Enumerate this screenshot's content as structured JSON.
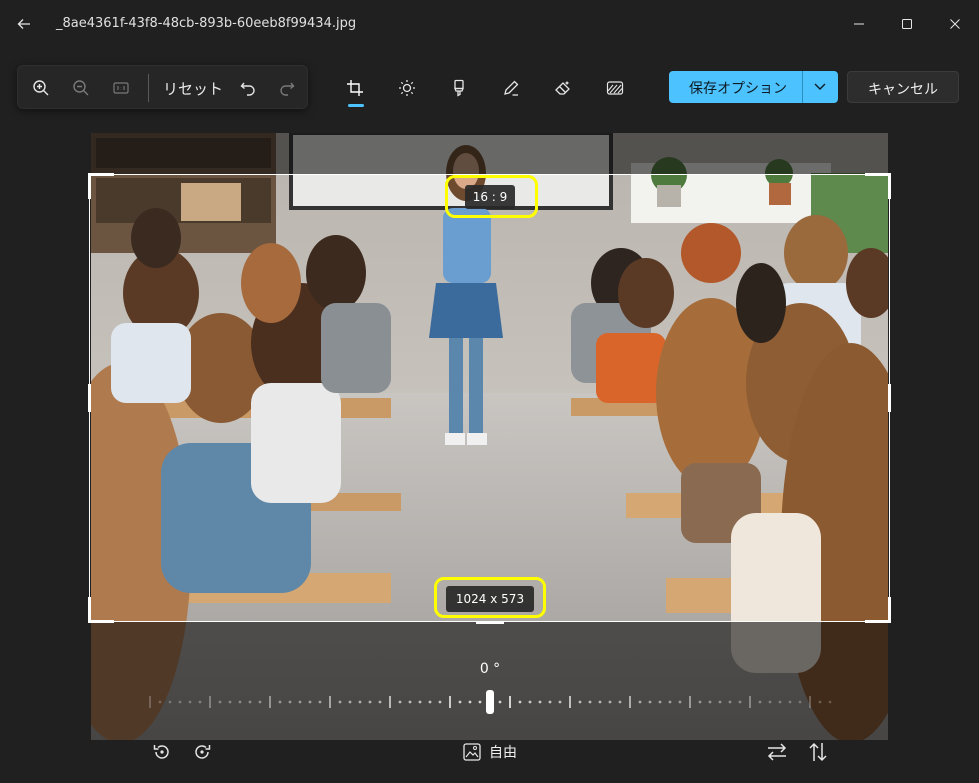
{
  "window": {
    "title": "_8ae4361f-43f8-48cb-893b-60eeb8f99434.jpg",
    "back_icon": "arrow-left-icon",
    "controls": [
      "minimize-icon",
      "maximize-icon",
      "close-icon"
    ]
  },
  "toolbar": {
    "zoom_in_icon": "zoom-in-icon",
    "zoom_out_icon": "zoom-out-icon",
    "actual_size_icon": "actual-size-icon",
    "reset_label": "リセット",
    "undo_icon": "undo-icon",
    "redo_icon": "redo-icon",
    "tools": [
      "crop-icon",
      "brightness-icon",
      "marker-icon",
      "pen-icon",
      "eraser-icon",
      "background-blur-icon"
    ],
    "active_tool": "crop",
    "save_label": "保存オプション",
    "cancel_label": "キャンセル"
  },
  "crop": {
    "aspect_ratio": "16 : 9",
    "dimensions": "1024 x 573"
  },
  "rotation": {
    "angle_label": "0 °"
  },
  "bottom": {
    "rotate_left_icon": "rotate-left-icon",
    "rotate_right_icon": "rotate-right-icon",
    "aspect_icon": "aspect-ratio-icon",
    "aspect_label": "自由",
    "flip_horizontal_icon": "flip-horizontal-icon",
    "flip_vertical_icon": "flip-vertical-icon"
  },
  "colors": {
    "background": "#202020",
    "accent": "#4cc2ff",
    "annotation": "#ffff00"
  }
}
